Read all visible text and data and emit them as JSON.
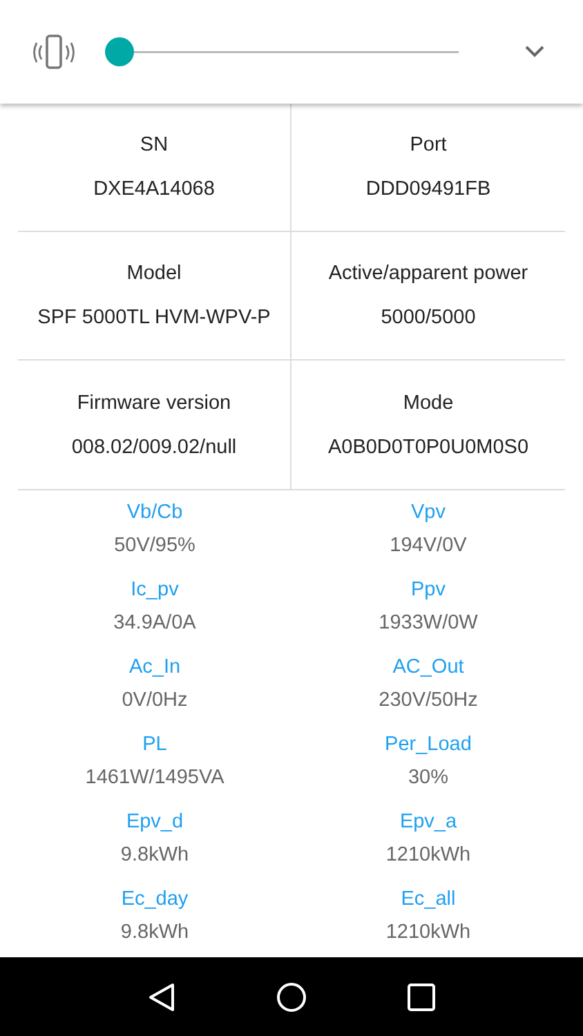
{
  "top_bar": {
    "slider": {
      "level": 0
    }
  },
  "info_grid": [
    {
      "label": "SN",
      "value": "DXE4A14068"
    },
    {
      "label": "Port",
      "value": "DDD09491FB"
    },
    {
      "label": "Model",
      "value": "SPF 5000TL HVM-WPV-P"
    },
    {
      "label": "Active/apparent power",
      "value": "5000/5000"
    },
    {
      "label": "Firmware version",
      "value": "008.02/009.02/null"
    },
    {
      "label": "Mode",
      "value": "A0B0D0T0P0U0M0S0"
    }
  ],
  "parameters": [
    {
      "label": "Vb/Cb",
      "value": "50V/95%"
    },
    {
      "label": "Vpv",
      "value": "194V/0V"
    },
    {
      "label": "Ic_pv",
      "value": "34.9A/0A"
    },
    {
      "label": "Ppv",
      "value": "1933W/0W"
    },
    {
      "label": "Ac_In",
      "value": "0V/0Hz"
    },
    {
      "label": "AC_Out",
      "value": "230V/50Hz"
    },
    {
      "label": "PL",
      "value": "1461W/1495VA"
    },
    {
      "label": "Per_Load",
      "value": "30%"
    },
    {
      "label": "Epv_d",
      "value": "9.8kWh"
    },
    {
      "label": "Epv_a",
      "value": "1210kWh"
    },
    {
      "label": "Ec_day",
      "value": "9.8kWh"
    },
    {
      "label": "Ec_all",
      "value": "1210kWh"
    }
  ]
}
